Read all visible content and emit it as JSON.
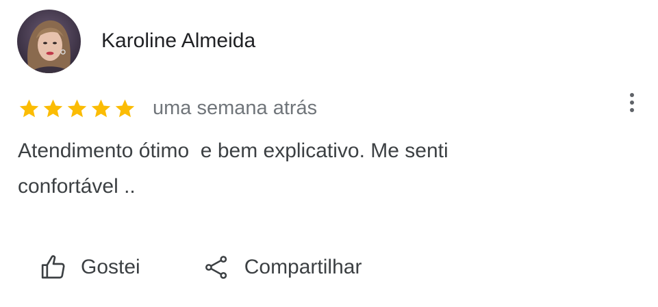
{
  "review": {
    "author_name": "Karoline Almeida",
    "rating": 5,
    "rating_max": 5,
    "time_ago": "uma semana atrás",
    "text": "Atendimento ótimo  e bem explicativo. Me senti\nconfortável ..",
    "more_icon": "more-vert-icon",
    "avatar_icon": "user-photo"
  },
  "actions": {
    "like_label": "Gostei",
    "like_icon": "thumb-up-icon",
    "share_label": "Compartilhar",
    "share_icon": "share-icon"
  },
  "colors": {
    "star": "#fbbc04",
    "text_primary": "#202124",
    "text_secondary": "#70757a",
    "icon": "#5f6368"
  }
}
